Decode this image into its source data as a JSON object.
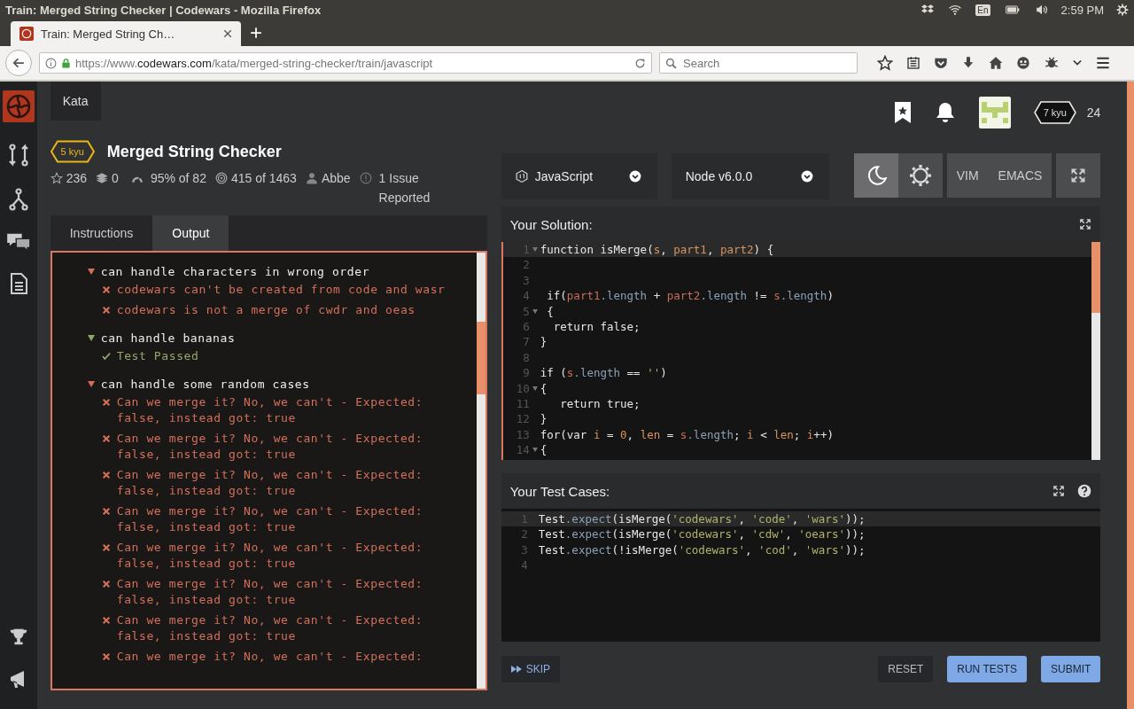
{
  "os_bar": {
    "title": "Train: Merged String Checker | Codewars - Mozilla Firefox",
    "keyboard": "En",
    "clock": "2:59 PM"
  },
  "browser": {
    "tab_title": "Train: Merged String Ch…",
    "url_prefix": "https://www.",
    "url_domain": "codewars.com",
    "url_path": "/kata/merged-string-checker/train/javascript",
    "search_placeholder": "Search"
  },
  "nav_tab": "Kata",
  "user": {
    "rank": "7 kyu",
    "honor": "24"
  },
  "kata": {
    "rank": "5 kyu",
    "title": "Merged String Checker",
    "stats": [
      {
        "kind": "stars",
        "text": "236"
      },
      {
        "kind": "collections",
        "text": "0"
      },
      {
        "kind": "satisfaction",
        "text": "95% of 82"
      },
      {
        "kind": "completions",
        "text": "415 of 1463"
      },
      {
        "kind": "author",
        "text": "Abbe"
      },
      {
        "kind": "issues",
        "text": "1 Issue Reported"
      }
    ]
  },
  "language": "JavaScript",
  "version": "Node v6.0.0",
  "themes": [
    {
      "kind": "dark",
      "selected": true
    },
    {
      "kind": "light",
      "selected": false
    }
  ],
  "modes": [
    {
      "label": "VIM",
      "selected": false
    },
    {
      "label": "EMACS",
      "selected": false
    }
  ],
  "tabs": [
    {
      "label": "Instructions",
      "selected": false
    },
    {
      "label": "Output",
      "selected": true
    }
  ],
  "output": [
    {
      "title": "can handle characters in wrong order",
      "passed": false,
      "results": [
        {
          "passed": false,
          "text": "codewars can't be created from code and wasr"
        },
        {
          "passed": false,
          "text": "codewars is not a merge of cwdr and oeas"
        }
      ]
    },
    {
      "title": "can handle bananas",
      "passed": true,
      "results": [
        {
          "passed": true,
          "text": "Test Passed"
        }
      ]
    },
    {
      "title": "can handle some random cases",
      "passed": false,
      "results": [
        {
          "passed": false,
          "text": "Can we merge it? No, we can't - Expected: false, instead got: true"
        },
        {
          "passed": false,
          "text": "Can we merge it? No, we can't - Expected: false, instead got: true"
        },
        {
          "passed": false,
          "text": "Can we merge it? No, we can't - Expected: false, instead got: true"
        },
        {
          "passed": false,
          "text": "Can we merge it? No, we can't - Expected: false, instead got: true"
        },
        {
          "passed": false,
          "text": "Can we merge it? No, we can't - Expected: false, instead got: true"
        },
        {
          "passed": false,
          "text": "Can we merge it? No, we can't - Expected: false, instead got: true"
        },
        {
          "passed": false,
          "text": "Can we merge it? No, we can't - Expected: false, instead got: true"
        },
        {
          "passed": false,
          "text": "Can we merge it? No, we can't - Expected:"
        }
      ]
    }
  ],
  "solution": {
    "title": "Your Solution:",
    "lines": [
      {
        "number": "1",
        "fold": true,
        "active": true,
        "tokens": [
          {
            "kind": "plain",
            "text": "function isMerge("
          },
          {
            "kind": "param",
            "text": "s"
          },
          {
            "kind": "plain",
            "text": ", "
          },
          {
            "kind": "param",
            "text": "part1"
          },
          {
            "kind": "plain",
            "text": ", "
          },
          {
            "kind": "param",
            "text": "part2"
          },
          {
            "kind": "plain",
            "text": ") {"
          }
        ]
      },
      {
        "number": "2",
        "fold": false,
        "active": false
      },
      {
        "number": "3",
        "fold": false,
        "active": false
      },
      {
        "number": "4",
        "fold": false,
        "active": false,
        "tokens": [
          {
            "kind": "plain",
            "text": " if("
          },
          {
            "kind": "var",
            "text": "part1"
          },
          {
            "kind": "prop",
            "text": ".length"
          },
          {
            "kind": "plain",
            "text": " + "
          },
          {
            "kind": "var",
            "text": "part2"
          },
          {
            "kind": "prop",
            "text": ".length"
          },
          {
            "kind": "plain",
            "text": " != "
          },
          {
            "kind": "var",
            "text": "s"
          },
          {
            "kind": "prop",
            "text": ".length"
          },
          {
            "kind": "plain",
            "text": ")"
          }
        ]
      },
      {
        "number": "5",
        "fold": true,
        "active": false,
        "tokens": [
          {
            "kind": "plain",
            "text": " {"
          }
        ]
      },
      {
        "number": "6",
        "fold": false,
        "active": false,
        "tokens": [
          {
            "kind": "plain",
            "text": "  return false;"
          }
        ]
      },
      {
        "number": "7",
        "fold": false,
        "active": false,
        "tokens": [
          {
            "kind": "plain",
            "text": "}"
          }
        ]
      },
      {
        "number": "8",
        "fold": false,
        "active": false
      },
      {
        "number": "9",
        "fold": false,
        "active": false,
        "tokens": [
          {
            "kind": "plain",
            "text": "if ("
          },
          {
            "kind": "var",
            "text": "s"
          },
          {
            "kind": "prop",
            "text": ".length"
          },
          {
            "kind": "plain",
            "text": " == "
          },
          {
            "kind": "str",
            "text": "''"
          },
          {
            "kind": "plain",
            "text": ")"
          }
        ]
      },
      {
        "number": "10",
        "fold": true,
        "active": false,
        "tokens": [
          {
            "kind": "plain",
            "text": "{"
          }
        ]
      },
      {
        "number": "11",
        "fold": false,
        "active": false,
        "tokens": [
          {
            "kind": "plain",
            "text": "   return true;"
          }
        ]
      },
      {
        "number": "12",
        "fold": false,
        "active": false,
        "tokens": [
          {
            "kind": "plain",
            "text": "}"
          }
        ]
      },
      {
        "number": "13",
        "fold": false,
        "active": false,
        "tokens": [
          {
            "kind": "plain",
            "text": "for(var "
          },
          {
            "kind": "param",
            "text": "i"
          },
          {
            "kind": "plain",
            "text": " = "
          },
          {
            "kind": "num",
            "text": "0"
          },
          {
            "kind": "plain",
            "text": ", "
          },
          {
            "kind": "param",
            "text": "len"
          },
          {
            "kind": "plain",
            "text": " = "
          },
          {
            "kind": "var",
            "text": "s"
          },
          {
            "kind": "prop",
            "text": ".length"
          },
          {
            "kind": "plain",
            "text": "; "
          },
          {
            "kind": "param",
            "text": "i"
          },
          {
            "kind": "plain",
            "text": " < "
          },
          {
            "kind": "param",
            "text": "len"
          },
          {
            "kind": "plain",
            "text": "; "
          },
          {
            "kind": "param",
            "text": "i"
          },
          {
            "kind": "plain",
            "text": "++)"
          }
        ]
      },
      {
        "number": "14",
        "fold": true,
        "active": false,
        "tokens": [
          {
            "kind": "plain",
            "text": "{"
          }
        ]
      }
    ]
  },
  "tests": {
    "title": "Your Test Cases:",
    "lines": [
      {
        "number": "1",
        "fold": false,
        "active": true,
        "tokens": [
          {
            "kind": "plain",
            "text": "Test"
          },
          {
            "kind": "prop",
            "text": ".expect"
          },
          {
            "kind": "plain",
            "text": "(isMerge("
          },
          {
            "kind": "str",
            "text": "'codewars'"
          },
          {
            "kind": "plain",
            "text": ", "
          },
          {
            "kind": "str",
            "text": "'code'"
          },
          {
            "kind": "plain",
            "text": ", "
          },
          {
            "kind": "str",
            "text": "'wars'"
          },
          {
            "kind": "plain",
            "text": "));"
          }
        ]
      },
      {
        "number": "2",
        "fold": false,
        "active": false,
        "tokens": [
          {
            "kind": "plain",
            "text": "Test"
          },
          {
            "kind": "prop",
            "text": ".expect"
          },
          {
            "kind": "plain",
            "text": "(isMerge("
          },
          {
            "kind": "str",
            "text": "'codewars'"
          },
          {
            "kind": "plain",
            "text": ", "
          },
          {
            "kind": "str",
            "text": "'cdw'"
          },
          {
            "kind": "plain",
            "text": ", "
          },
          {
            "kind": "str",
            "text": "'oears'"
          },
          {
            "kind": "plain",
            "text": "));"
          }
        ]
      },
      {
        "number": "3",
        "fold": false,
        "active": false,
        "tokens": [
          {
            "kind": "plain",
            "text": "Test"
          },
          {
            "kind": "prop",
            "text": ".expect"
          },
          {
            "kind": "plain",
            "text": "(!isMerge("
          },
          {
            "kind": "str",
            "text": "'codewars'"
          },
          {
            "kind": "plain",
            "text": ", "
          },
          {
            "kind": "str",
            "text": "'cod'"
          },
          {
            "kind": "plain",
            "text": ", "
          },
          {
            "kind": "str",
            "text": "'wars'"
          },
          {
            "kind": "plain",
            "text": "));"
          }
        ]
      },
      {
        "number": "4",
        "fold": false,
        "active": false
      }
    ]
  },
  "buttons": {
    "skip": "SKIP",
    "reset": "RESET",
    "run": "RUN TESTS",
    "submit": "SUBMIT"
  }
}
